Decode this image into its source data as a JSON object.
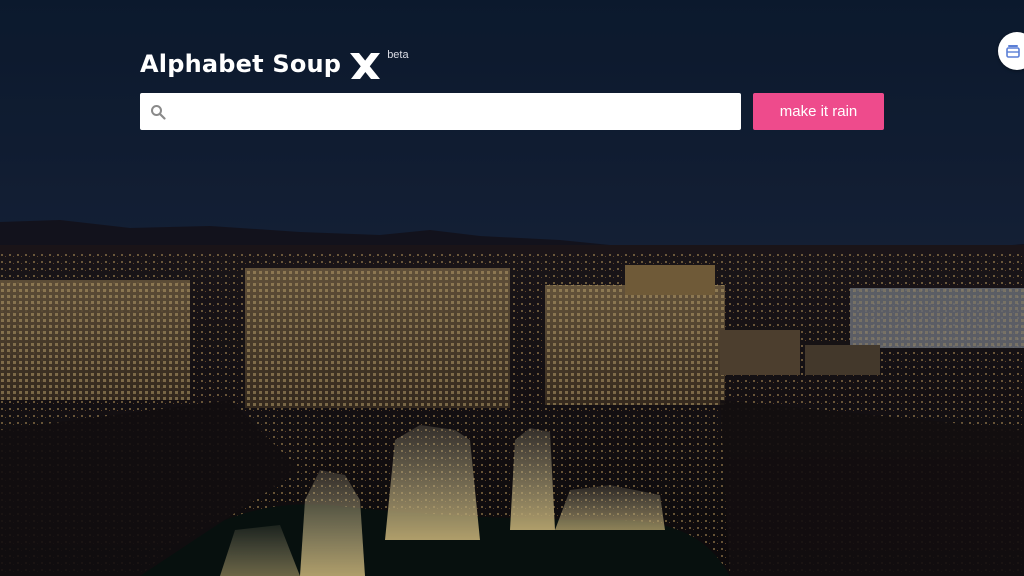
{
  "app": {
    "title": "Alphabet Soup",
    "badge": "beta"
  },
  "search": {
    "value": "",
    "placeholder": ""
  },
  "actions": {
    "submit_label": "make it rain"
  },
  "icons": {
    "logo": "x-logo-icon",
    "search": "search-icon",
    "corner": "layers-icon"
  },
  "colors": {
    "accent": "#ee4b8c",
    "corner_icon": "#5b7fd6"
  }
}
